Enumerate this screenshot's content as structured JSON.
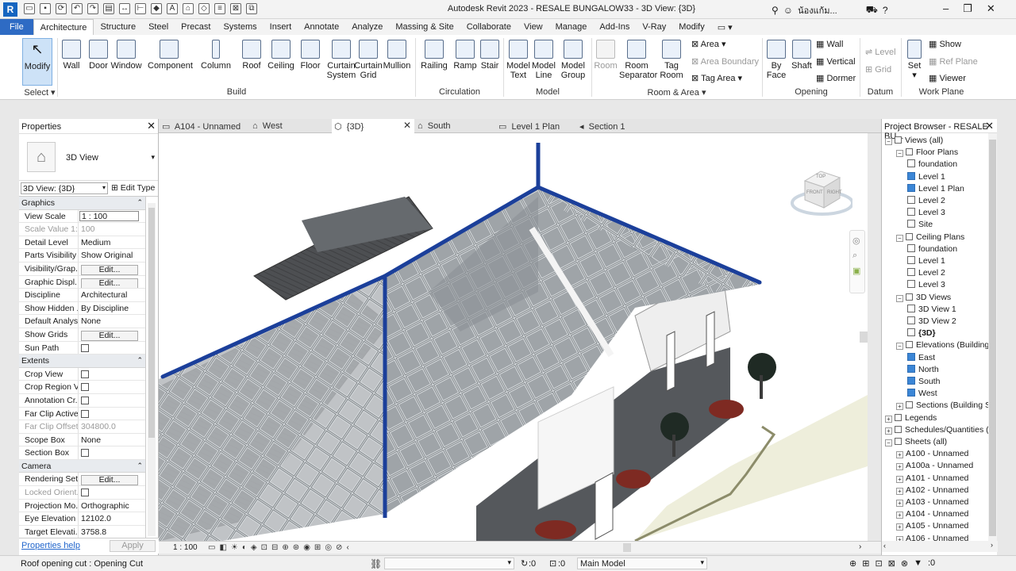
{
  "window": {
    "title": "Autodesk Revit 2023 - RESALE BUNGALOW33 - 3D View: {3D}",
    "logo": "R",
    "search_text": "ซ๎ย กับเส..."
  },
  "user": {
    "name": "น้องแก้ม..."
  },
  "menu_tabs": [
    "File",
    "Architecture",
    "Structure",
    "Steel",
    "Precast",
    "Systems",
    "Insert",
    "Annotate",
    "Analyze",
    "Massing & Site",
    "Collaborate",
    "View",
    "Manage",
    "Add-Ins",
    "V-Ray",
    "Modify"
  ],
  "ribbon": {
    "modify": "Modify",
    "select": "Select",
    "build": {
      "label": "Build",
      "buttons": [
        "Wall",
        "Door",
        "Window",
        "Component",
        "Column",
        "Roof",
        "Ceiling",
        "Floor",
        "Curtain System",
        "Curtain Grid",
        "Mullion"
      ]
    },
    "circulation": {
      "label": "Circulation",
      "buttons": [
        "Railing",
        "Ramp",
        "Stair"
      ]
    },
    "model": {
      "label": "Model",
      "buttons": [
        "Model Text",
        "Model Line",
        "Model Group"
      ]
    },
    "room_area": {
      "label": "Room & Area",
      "buttons": [
        "Room",
        "Room Separator",
        "Tag Room"
      ],
      "small": [
        "Area",
        "Area Boundary",
        "Tag Area"
      ]
    },
    "opening": {
      "label": "Opening",
      "buttons": [
        "By Face",
        "Shaft"
      ],
      "small": [
        "Wall",
        "Vertical",
        "Dormer"
      ]
    },
    "datum": {
      "label": "Datum",
      "small": [
        "Level",
        "Grid"
      ]
    },
    "work_plane": {
      "label": "Work Plane",
      "set": "Set",
      "small": [
        "Show",
        "Ref Plane",
        "Viewer"
      ]
    }
  },
  "properties": {
    "title": "Properties",
    "type_name": "3D View",
    "selector": "3D View: {3D}",
    "edit_type": "Edit Type",
    "sections": {
      "graphics": "Graphics",
      "extents": "Extents",
      "camera": "Camera"
    },
    "graphics_rows": [
      {
        "k": "View Scale",
        "v": "1 : 100"
      },
      {
        "k": "Scale Value    1:",
        "v": "100"
      },
      {
        "k": "Detail Level",
        "v": "Medium"
      },
      {
        "k": "Parts Visibility",
        "v": "Show Original"
      },
      {
        "k": "Visibility/Grap...",
        "v": "Edit..."
      },
      {
        "k": "Graphic Displ...",
        "v": "Edit..."
      },
      {
        "k": "Discipline",
        "v": "Architectural"
      },
      {
        "k": "Show Hidden ...",
        "v": "By Discipline"
      },
      {
        "k": "Default Analys...",
        "v": "None"
      },
      {
        "k": "Show Grids",
        "v": "Edit..."
      },
      {
        "k": "Sun Path",
        "v": ""
      }
    ],
    "extents_rows": [
      {
        "k": "Crop View",
        "v": ""
      },
      {
        "k": "Crop Region V...",
        "v": ""
      },
      {
        "k": "Annotation Cr...",
        "v": ""
      },
      {
        "k": "Far Clip Active",
        "v": ""
      },
      {
        "k": "Far Clip Offset",
        "v": "304800.0"
      },
      {
        "k": "Scope Box",
        "v": "None"
      },
      {
        "k": "Section Box",
        "v": ""
      }
    ],
    "camera_rows": [
      {
        "k": "Rendering Set...",
        "v": "Edit..."
      },
      {
        "k": "Locked Orient...",
        "v": ""
      },
      {
        "k": "Projection Mo...",
        "v": "Orthographic"
      },
      {
        "k": "Eye Elevation",
        "v": "12102.0"
      },
      {
        "k": "Target Elevati...",
        "v": "3758.8"
      }
    ],
    "help": "Properties help",
    "apply": "Apply"
  },
  "view_tabs": [
    "A104 - Unnamed",
    "West",
    "{3D}",
    "South",
    "Level 1 Plan",
    "Section 1"
  ],
  "view_bar": {
    "scale": "1 : 100"
  },
  "project_browser": {
    "title": "Project Browser - RESALE BU...",
    "rows": [
      "Views (all)",
      "Floor Plans",
      "foundation",
      "Level 1",
      "Level 1 Plan",
      "Level 2",
      "Level 3",
      "Site",
      "Ceiling Plans",
      "foundation",
      "Level 1",
      "Level 2",
      "Level 3",
      "3D Views",
      "3D View 1",
      "3D View 2",
      "{3D}",
      "Elevations (Building E",
      "East",
      "North",
      "South",
      "West",
      "Sections (Building Sec",
      "Legends",
      "Schedules/Quantities (",
      "Sheets (all)",
      "A100 - Unnamed",
      "A100a - Unnamed",
      "A101 - Unnamed",
      "A102 - Unnamed",
      "A103 - Unnamed",
      "A104 - Unnamed",
      "A105 - Unnamed",
      "A106 - Unnamed"
    ]
  },
  "status": {
    "message": "Roof opening cut : Opening Cut",
    "zero1": ":0",
    "zero2": ":0",
    "model": "Main Model"
  },
  "viewcube": {
    "top": "TOP",
    "front": "FRONT",
    "right": "RIGHT"
  }
}
